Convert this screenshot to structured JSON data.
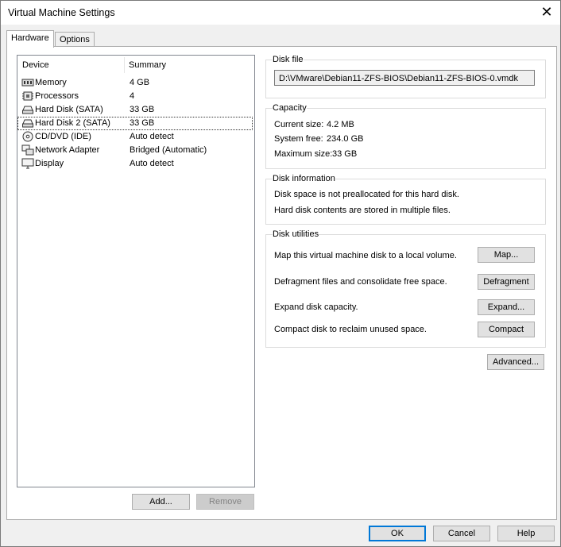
{
  "window": {
    "title": "Virtual Machine Settings",
    "close_glyph": "✕"
  },
  "tabs": [
    {
      "label": "Hardware"
    },
    {
      "label": "Options"
    }
  ],
  "device_list": {
    "col_device": "Device",
    "col_summary": "Summary",
    "rows": [
      {
        "name": "Memory",
        "summary": "4 GB",
        "icon": "memory-icon"
      },
      {
        "name": "Processors",
        "summary": "4",
        "icon": "processor-icon"
      },
      {
        "name": "Hard Disk (SATA)",
        "summary": "33 GB",
        "icon": "hard-disk-icon"
      },
      {
        "name": "Hard Disk 2 (SATA)",
        "summary": "33 GB",
        "icon": "hard-disk-icon",
        "selected": true
      },
      {
        "name": "CD/DVD (IDE)",
        "summary": "Auto detect",
        "icon": "cd-dvd-icon"
      },
      {
        "name": "Network Adapter",
        "summary": "Bridged (Automatic)",
        "icon": "network-adapter-icon"
      },
      {
        "name": "Display",
        "summary": "Auto detect",
        "icon": "display-icon"
      }
    ],
    "add_label": "Add...",
    "remove_label": "Remove"
  },
  "disk_file": {
    "title": "Disk file",
    "path": "D:\\VMware\\Debian11-ZFS-BIOS\\Debian11-ZFS-BIOS-0.vmdk"
  },
  "capacity": {
    "title": "Capacity",
    "current_label": "Current size:",
    "current_value": "4.2 MB",
    "free_label": "System free:",
    "free_value": "234.0 GB",
    "max_label": "Maximum size:",
    "max_value": "33 GB"
  },
  "disk_info": {
    "title": "Disk information",
    "line1": "Disk space is not preallocated for this hard disk.",
    "line2": "Hard disk contents are stored in multiple files."
  },
  "disk_utilities": {
    "title": "Disk utilities",
    "map_text": "Map this virtual machine disk to a local volume.",
    "map_label": "Map...",
    "defrag_text": "Defragment files and consolidate free space.",
    "defrag_label": "Defragment",
    "expand_text": "Expand disk capacity.",
    "expand_label": "Expand...",
    "compact_text": "Compact disk to reclaim unused space.",
    "compact_label": "Compact"
  },
  "advanced_label": "Advanced...",
  "footer": {
    "ok_label": "OK",
    "cancel_label": "Cancel",
    "help_label": "Help"
  },
  "colors": {
    "accent": "#0078d7",
    "border": "#adadad",
    "background": "#f0f0f0"
  }
}
